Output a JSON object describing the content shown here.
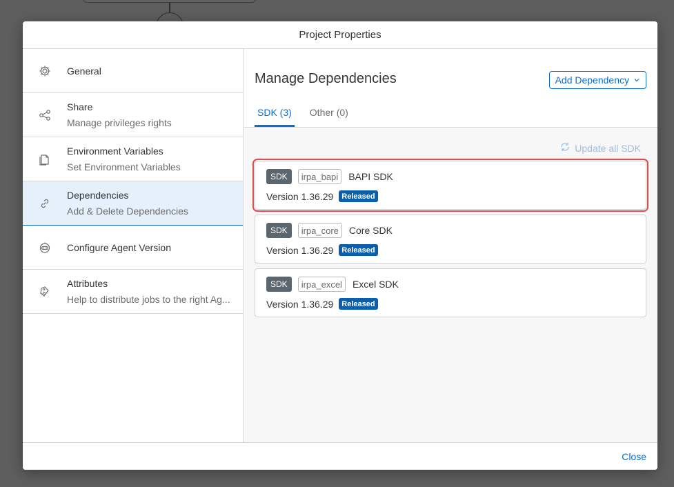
{
  "dialog": {
    "title": "Project Properties"
  },
  "sidebar": {
    "items": [
      {
        "title": "General",
        "subtitle": "",
        "icon": "gear-icon"
      },
      {
        "title": "Share",
        "subtitle": "Manage privileges rights",
        "icon": "share-icon"
      },
      {
        "title": "Environment Variables",
        "subtitle": "Set Environment Variables",
        "icon": "documents-icon"
      },
      {
        "title": "Dependencies",
        "subtitle": "Add & Delete Dependencies",
        "icon": "link-icon"
      },
      {
        "title": "Configure Agent Version",
        "subtitle": "",
        "icon": "robot-icon"
      },
      {
        "title": "Attributes",
        "subtitle": "Help to distribute jobs to the right Ag...",
        "icon": "tag-icon"
      }
    ],
    "selected_index": 3
  },
  "main": {
    "title": "Manage Dependencies",
    "add_dependency_label": "Add Dependency",
    "tabs": [
      {
        "label": "SDK (3)",
        "active": true
      },
      {
        "label": "Other (0)",
        "active": false
      }
    ],
    "update_all_label": "Update all SDK",
    "sdks": [
      {
        "badge": "SDK",
        "id": "irpa_bapi",
        "name": "BAPI SDK",
        "version": "Version 1.36.29",
        "status": "Released",
        "highlighted": true
      },
      {
        "badge": "SDK",
        "id": "irpa_core",
        "name": "Core SDK",
        "version": "Version 1.36.29",
        "status": "Released",
        "highlighted": false
      },
      {
        "badge": "SDK",
        "id": "irpa_excel",
        "name": "Excel SDK",
        "version": "Version 1.36.29",
        "status": "Released",
        "highlighted": false
      }
    ]
  },
  "footer": {
    "close_label": "Close"
  },
  "colors": {
    "accent": "#0a6ed1",
    "highlight": "#e34c4c",
    "released": "#0a5fad",
    "selected_bg": "#e5f0fa"
  }
}
